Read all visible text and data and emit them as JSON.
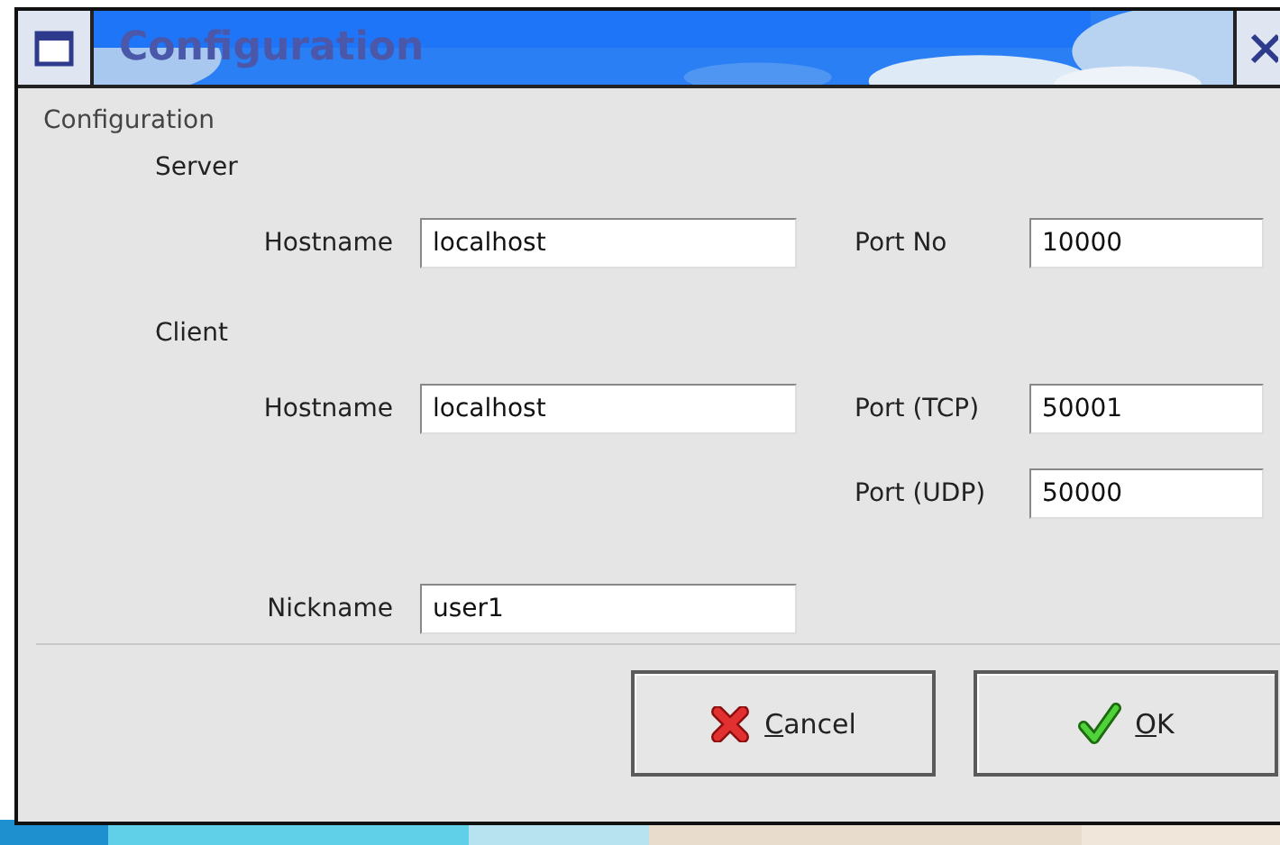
{
  "window": {
    "title": "Configuration"
  },
  "heading": "Configuration",
  "sections": [
    {
      "title": "Server",
      "rows": [
        {
          "left": {
            "label": "Hostname",
            "value": "localhost"
          },
          "right": {
            "label": "Port No",
            "value": "10000"
          }
        }
      ]
    },
    {
      "title": "Client",
      "rows": [
        {
          "left": {
            "label": "Hostname",
            "value": "localhost"
          },
          "right": {
            "label": "Port (TCP)",
            "value": "50001"
          }
        },
        {
          "right": {
            "label": "Port (UDP)",
            "value": "50000"
          }
        }
      ]
    }
  ],
  "nickname": {
    "label": "Nickname",
    "value": "user1"
  },
  "buttons": [
    {
      "label": "Cancel",
      "kind": "cancel"
    },
    {
      "label": "OK",
      "kind": "ok"
    }
  ]
}
